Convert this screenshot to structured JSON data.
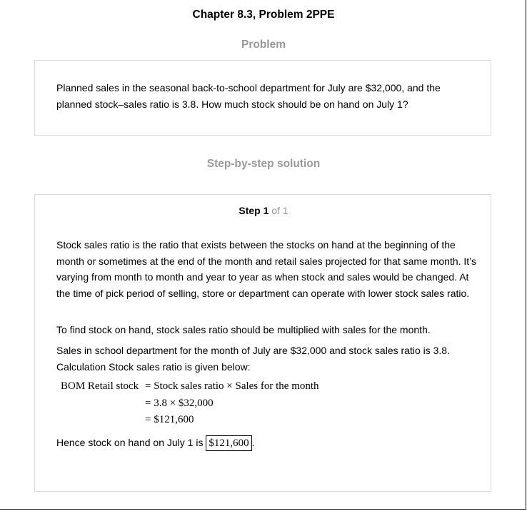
{
  "header": {
    "title": "Chapter 8.3, Problem 2PPE"
  },
  "problem": {
    "heading": "Problem",
    "text": "Planned sales in the seasonal back-to-school department for July are $32,000, and the planned stock–sales ratio is 3.8. How much stock should be on hand on July 1?"
  },
  "solution": {
    "heading": "Step-by-step solution",
    "step": {
      "label": "Step",
      "number": "1",
      "of": "of 1"
    },
    "paragraphs": [
      "Stock sales ratio is the ratio that exists between the stocks on hand at the beginning of the month or sometimes at the end of the month and retail sales projected for that same month. It’s varying from month to month and year to year as when stock and sales would be changed. At the time of pick period of selling, store or department can operate with lower stock sales ratio.",
      "To find stock on hand, stock sales ratio should be multiplied with sales for the month.",
      "Sales in school department for the month of July are $32,000 and stock sales ratio is 3.8. Calculation Stock sales ratio is given below:"
    ],
    "equation": {
      "line1_lhs": "BOM Retail stock",
      "line1_rhs": "= Stock sales ratio × Sales for the month",
      "line2": "= 3.8 × $32,000",
      "line3": "= $121,600"
    },
    "conclusion": {
      "prefix": "Hence stock on hand on July 1 is",
      "answer": "$121,600",
      "suffix": "."
    }
  }
}
